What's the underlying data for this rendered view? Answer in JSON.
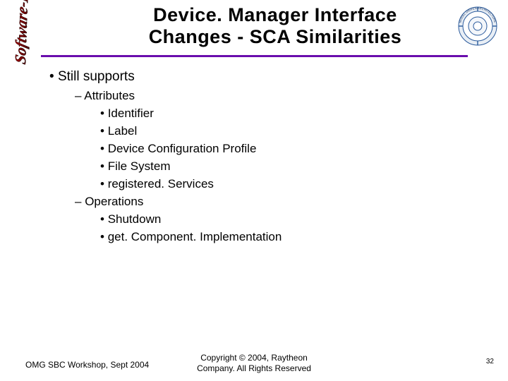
{
  "decorative_text": "Software-Based",
  "logo_label": "Model Driven Architecture",
  "title_line1": "Device. Manager Interface",
  "title_line2": "Changes - SCA Similarities",
  "body": {
    "top": "Still supports",
    "attributes_label": "Attributes",
    "attributes": [
      "Identifier",
      "Label",
      "Device Configuration Profile",
      "File System",
      "registered. Services"
    ],
    "operations_label": "Operations",
    "operations": [
      "Shutdown",
      "get. Component. Implementation"
    ]
  },
  "footer": {
    "left": "OMG SBC Workshop, Sept 2004",
    "center_line1": "Copyright © 2004, Raytheon",
    "center_line2": "Company. All Rights Reserved",
    "page": "32"
  }
}
